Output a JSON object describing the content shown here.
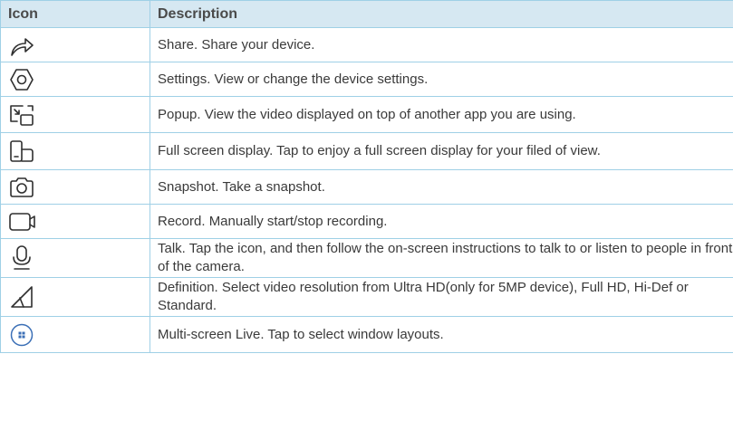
{
  "table": {
    "headers": {
      "icon": "Icon",
      "description": "Description"
    },
    "rows": [
      {
        "icon": "share-icon",
        "description": "Share. Share your device."
      },
      {
        "icon": "settings-icon",
        "description": "Settings. View or change the device settings."
      },
      {
        "icon": "popup-icon",
        "description": "Popup. View the video displayed on top of another app you are using."
      },
      {
        "icon": "fullscreen-icon",
        "description": "Full screen display. Tap to enjoy a full screen display for your filed of view."
      },
      {
        "icon": "camera-icon",
        "description": "Snapshot. Take a snapshot."
      },
      {
        "icon": "video-camera-icon",
        "description": "Record. Manually start/stop recording."
      },
      {
        "icon": "microphone-icon",
        "description": "Talk. Tap the icon, and then follow the on-screen instructions to talk to or listen to people in front of the camera."
      },
      {
        "icon": "signal-definition-icon",
        "description": "Definition. Select video resolution from Ultra HD(only for 5MP device), Full HD, Hi-Def or Standard."
      },
      {
        "icon": "multi-screen-icon",
        "description": "Multi-screen Live. Tap to select window layouts."
      }
    ]
  },
  "colors": {
    "header_bg": "#d6e8f2",
    "border": "#9fd0e6",
    "text": "#3a3a3a",
    "icon_stroke": "#2f2f2f",
    "multi_screen_accent": "#3b6fb6"
  }
}
